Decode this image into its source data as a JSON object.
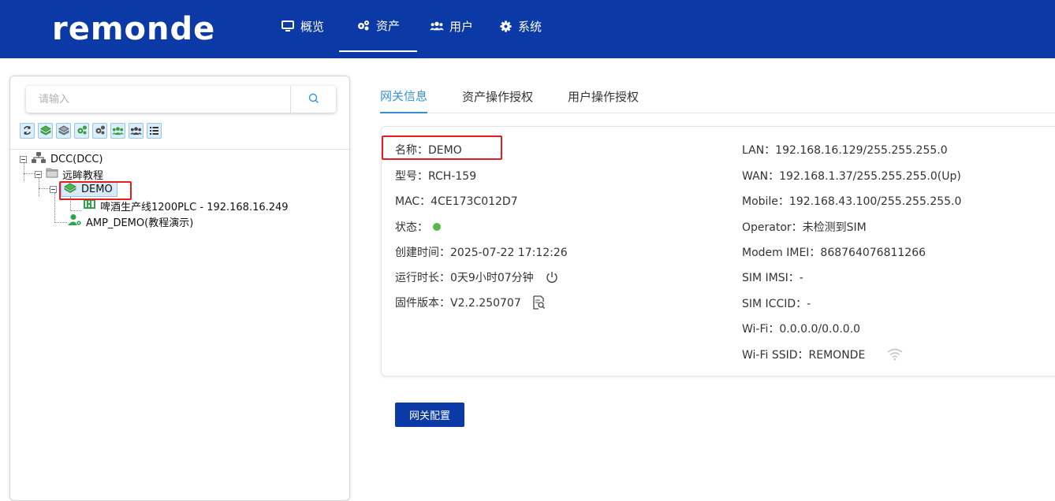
{
  "header": {
    "logo": "remonde",
    "nav": [
      {
        "label": "概览",
        "icon": "monitor-icon"
      },
      {
        "label": "资产",
        "icon": "gears-icon"
      },
      {
        "label": "用户",
        "icon": "users-icon"
      },
      {
        "label": "系统",
        "icon": "gear-icon"
      }
    ],
    "active_nav": "资产"
  },
  "sidebar": {
    "search": {
      "placeholder": "请输入",
      "value": ""
    },
    "toolbar": [
      "refresh-icon",
      "expand-layers-icon",
      "collapse-layers-icon",
      "gateway-gear-icon",
      "device-gear-icon",
      "user-group-icon",
      "users-icon",
      "list-icon"
    ],
    "tree": {
      "root": "DCC(DCC)",
      "folder": "远眸教程",
      "gateway": "DEMO",
      "device": "啤酒生产线1200PLC - 192.168.16.249",
      "user_node": "AMP_DEMO(教程演示)"
    }
  },
  "tabs": [
    {
      "label": "网关信息",
      "active": true
    },
    {
      "label": "资产操作授权",
      "active": false
    },
    {
      "label": "用户操作授权",
      "active": false
    }
  ],
  "gateway_info": {
    "name": "名称：DEMO",
    "model": "型号：RCH-159",
    "mac": "MAC：4CE173C012D7",
    "status_label": "状态：",
    "status_color": "#54b948",
    "created": "创建时间：2025-07-22 17:12:26",
    "uptime": "运行时长：0天9小时07分钟",
    "firmware": "固件版本：V2.2.250707",
    "lan": "LAN：192.168.16.129/255.255.255.0",
    "wan": "WAN：192.168.1.37/255.255.255.0(Up)",
    "mobile": "Mobile：192.168.43.100/255.255.255.0",
    "operator": "Operator：未检测到SIM",
    "modem_imei": "Modem IMEI：868764076811266",
    "sim_imsi": "SIM IMSI：-",
    "sim_iccid": "SIM ICCID：-",
    "wifi": "Wi-Fi：0.0.0.0/0.0.0.0",
    "wifi_ssid": "Wi-Fi SSID：REMONDE"
  },
  "actions": {
    "gateway_config": "网关配置"
  },
  "colors": {
    "brand": "#0b3aa6",
    "accent": "#3a8fd8",
    "highlight": "#e02020"
  }
}
